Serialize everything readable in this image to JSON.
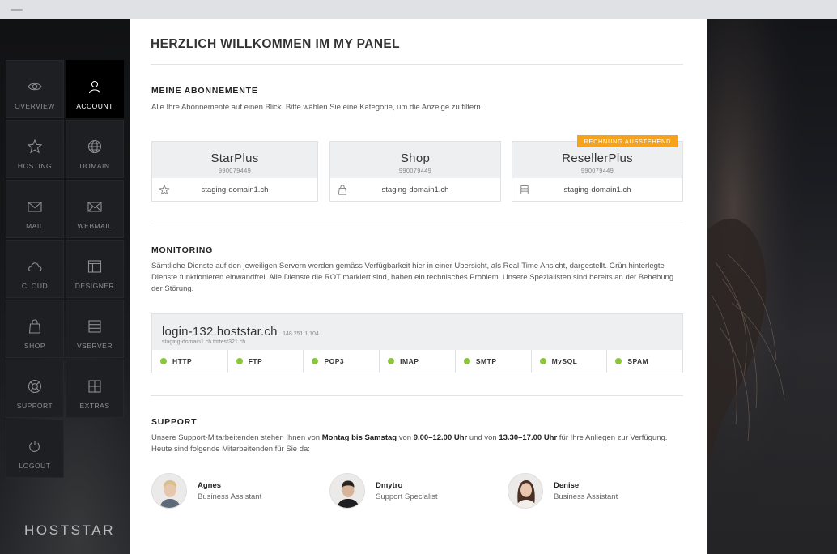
{
  "sidebar": {
    "items": [
      {
        "label": "OVERVIEW",
        "icon": "eye-icon",
        "active": false
      },
      {
        "label": "ACCOUNT",
        "icon": "user-icon",
        "active": true
      },
      {
        "label": "HOSTING",
        "icon": "star-icon",
        "active": false
      },
      {
        "label": "DOMAIN",
        "icon": "globe-icon",
        "active": false
      },
      {
        "label": "MAIL",
        "icon": "mail-icon",
        "active": false
      },
      {
        "label": "WEBMAIL",
        "icon": "webmail-icon",
        "active": false
      },
      {
        "label": "CLOUD",
        "icon": "cloud-icon",
        "active": false
      },
      {
        "label": "DESIGNER",
        "icon": "layout-icon",
        "active": false
      },
      {
        "label": "SHOP",
        "icon": "shopping-bag-icon",
        "active": false
      },
      {
        "label": "VSERVER",
        "icon": "server-icon",
        "active": false
      },
      {
        "label": "SUPPORT",
        "icon": "lifebuoy-icon",
        "active": false
      },
      {
        "label": "EXTRAS",
        "icon": "grid-icon",
        "active": false
      },
      {
        "label": "LOGOUT",
        "icon": "power-icon",
        "active": false
      }
    ],
    "logo": "HOSTSTAR"
  },
  "main": {
    "title": "HERZLICH WILLKOMMEN IM MY PANEL",
    "subscriptions": {
      "heading": "MEINE ABONNEMENTE",
      "description": "Alle Ihre Abonnemente auf einen Blick. Bitte wählen Sie eine Kategorie, um die Anzeige zu filtern.",
      "cards": [
        {
          "name": "StarPlus",
          "number": "990079449",
          "domain": "staging-domain1.ch",
          "icon": "star-icon",
          "badge": ""
        },
        {
          "name": "Shop",
          "number": "990079449",
          "domain": "staging-domain1.ch",
          "icon": "shopping-bag-icon",
          "badge": ""
        },
        {
          "name": "ResellerPlus",
          "number": "990079449",
          "domain": "staging-domain1.ch",
          "icon": "server-icon",
          "badge": "RECHNUNG AUSSTEHEND"
        }
      ]
    },
    "monitoring": {
      "heading": "MONITORING",
      "description": "Sämtliche Dienste auf den jeweiligen Servern werden gemäss Verfügbarkeit hier in einer Übersicht, als Real-Time Ansicht, dargestellt. Grün hinterlegte Dienste funktionieren einwandfrei. Alle Dienste die ROT markiert sind, haben ein technisches Problem. Unsere Spezialisten sind bereits an der Behebung der Störung.",
      "server": {
        "host": "login-132.hoststar.ch",
        "ip": "148.251.1.104",
        "subdomain": "staging-domain1.ch.tmtest321.ch"
      },
      "services": [
        {
          "name": "HTTP",
          "status_color": "#8cc63f"
        },
        {
          "name": "FTP",
          "status_color": "#8cc63f"
        },
        {
          "name": "POP3",
          "status_color": "#8cc63f"
        },
        {
          "name": "IMAP",
          "status_color": "#8cc63f"
        },
        {
          "name": "SMTP",
          "status_color": "#8cc63f"
        },
        {
          "name": "MySQL",
          "status_color": "#8cc63f"
        },
        {
          "name": "SPAM",
          "status_color": "#8cc63f"
        }
      ]
    },
    "support": {
      "heading": "SUPPORT",
      "text_1": "Unsere Support-Mitarbeitenden stehen Ihnen von ",
      "days": "Montag bis Samstag",
      "text_2": " von ",
      "hours_am": "9.00–12.00 Uhr",
      "text_3": " und von ",
      "hours_pm": "13.30–17.00 Uhr",
      "text_4": " für Ihre Anliegen zur Verfügung. Heute sind folgende Mitarbeitenden für Sie da:",
      "people": [
        {
          "name": "Agnes",
          "role": "Business Assistant"
        },
        {
          "name": "Dmytro",
          "role": "Support Specialist"
        },
        {
          "name": "Denise",
          "role": "Business Assistant"
        }
      ]
    }
  },
  "colors": {
    "accent_badge": "#f7a21b",
    "status_ok": "#8cc63f",
    "sidebar_active": "#000000"
  }
}
